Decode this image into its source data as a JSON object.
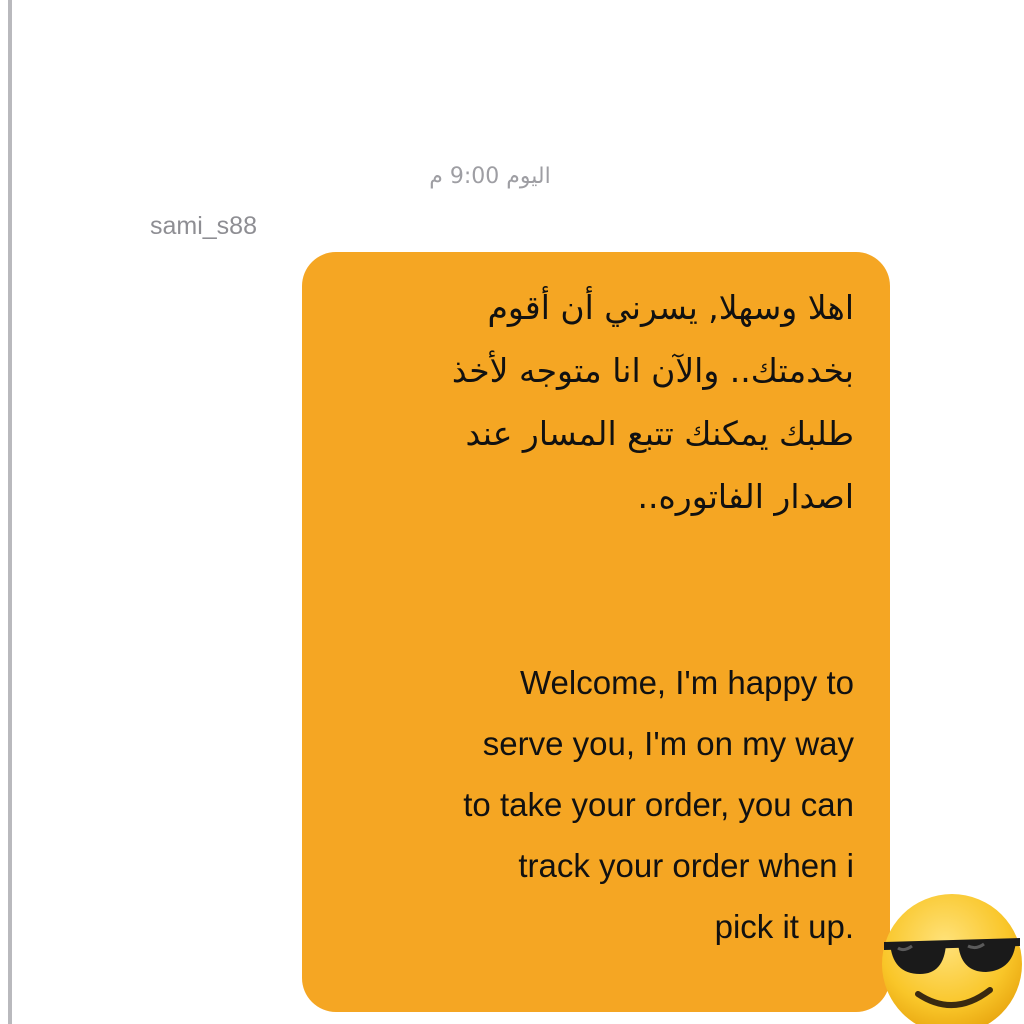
{
  "chat": {
    "timestamp": "اليوم 9:00 م",
    "sender": "sami_s88",
    "message": {
      "arabic": "اهلا وسهلا, يسرني أن أقوم\nبخدمتك.. والآن انا متوجه لأخذ\nطلبك يمكنك تتبع المسار عند\nاصدار الفاتوره..",
      "english": "Welcome, I'm happy to\nserve you, I'm on my way\nto take your order, you can\ntrack your order when i\npick it up."
    },
    "reaction_icon": "sunglasses-emoji-icon",
    "bubble_color": "#f5a623"
  }
}
